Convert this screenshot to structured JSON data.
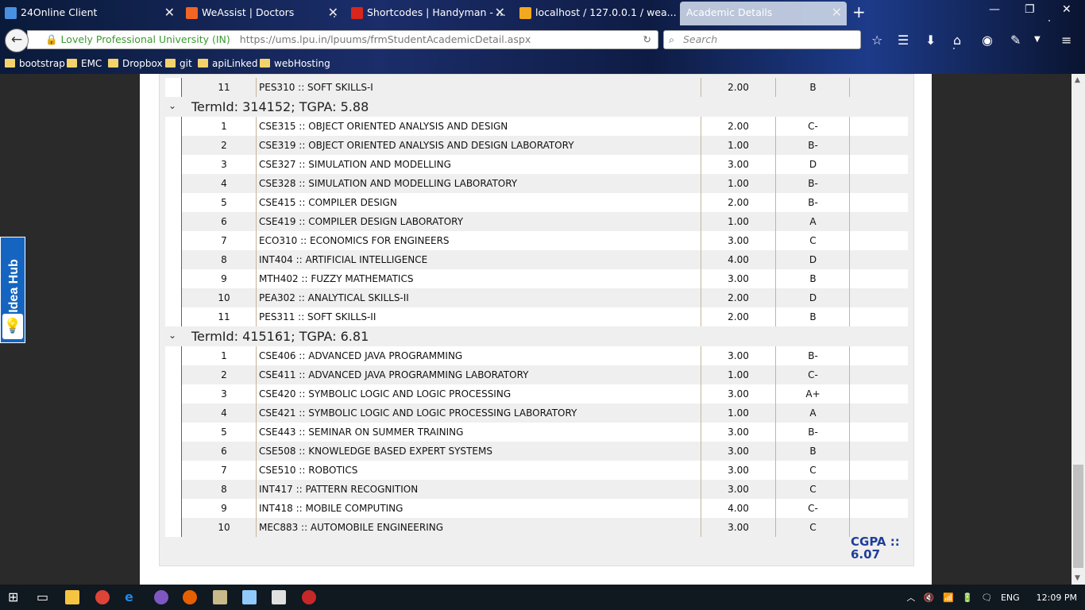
{
  "browser": {
    "tabs": [
      {
        "label": "24Online Client",
        "icon": "cloud-icon",
        "color": "#4a90e2"
      },
      {
        "label": "WeAssist | Doctors",
        "icon": "weassist-icon",
        "color": "#f26522"
      },
      {
        "label": "Shortcodes | Handyman - ...",
        "icon": "home-icon",
        "color": "#d9261c"
      },
      {
        "label": "localhost / 127.0.0.1 / wea...",
        "icon": "phpmyadmin-icon",
        "color": "#f4a81d"
      },
      {
        "label": "Academic Details",
        "icon": "",
        "color": ""
      }
    ],
    "new_tab": "+",
    "url_org": "Lovely Professional University (IN)",
    "url": "https://ums.lpu.in/lpuums/frmStudentAcademicDetail.aspx",
    "search_placeholder": "Search",
    "bookmarks": [
      "bootstrap",
      "EMC",
      "Dropbox",
      "git",
      "apiLinked",
      "webHosting"
    ]
  },
  "academic": {
    "top_row": {
      "sno": "11",
      "course": "PES310 :: SOFT SKILLS-I",
      "credits": "2.00",
      "grade": "B"
    },
    "terms": [
      {
        "title": "TermId: 314152; TGPA: 5.88",
        "rows": [
          {
            "sno": "1",
            "course": "CSE315 :: OBJECT ORIENTED ANALYSIS AND DESIGN",
            "credits": "2.00",
            "grade": "C-"
          },
          {
            "sno": "2",
            "course": "CSE319 :: OBJECT ORIENTED ANALYSIS AND DESIGN LABORATORY",
            "credits": "1.00",
            "grade": "B-"
          },
          {
            "sno": "3",
            "course": "CSE327 :: SIMULATION AND MODELLING",
            "credits": "3.00",
            "grade": "D"
          },
          {
            "sno": "4",
            "course": "CSE328 :: SIMULATION AND MODELLING LABORATORY",
            "credits": "1.00",
            "grade": "B-"
          },
          {
            "sno": "5",
            "course": "CSE415 :: COMPILER DESIGN",
            "credits": "2.00",
            "grade": "B-"
          },
          {
            "sno": "6",
            "course": "CSE419 :: COMPILER DESIGN LABORATORY",
            "credits": "1.00",
            "grade": "A"
          },
          {
            "sno": "7",
            "course": "ECO310 :: ECONOMICS FOR ENGINEERS",
            "credits": "3.00",
            "grade": "C"
          },
          {
            "sno": "8",
            "course": "INT404 :: ARTIFICIAL INTELLIGENCE",
            "credits": "4.00",
            "grade": "D"
          },
          {
            "sno": "9",
            "course": "MTH402 :: FUZZY MATHEMATICS",
            "credits": "3.00",
            "grade": "B"
          },
          {
            "sno": "10",
            "course": "PEA302 :: ANALYTICAL SKILLS-II",
            "credits": "2.00",
            "grade": "D"
          },
          {
            "sno": "11",
            "course": "PES311 :: SOFT SKILLS-II",
            "credits": "2.00",
            "grade": "B"
          }
        ]
      },
      {
        "title": "TermId: 415161; TGPA: 6.81",
        "rows": [
          {
            "sno": "1",
            "course": "CSE406 :: ADVANCED JAVA PROGRAMMING",
            "credits": "3.00",
            "grade": "B-"
          },
          {
            "sno": "2",
            "course": "CSE411 :: ADVANCED JAVA PROGRAMMING LABORATORY",
            "credits": "1.00",
            "grade": "C-"
          },
          {
            "sno": "3",
            "course": "CSE420 :: SYMBOLIC LOGIC AND LOGIC PROCESSING",
            "credits": "3.00",
            "grade": "A+"
          },
          {
            "sno": "4",
            "course": "CSE421 :: SYMBOLIC LOGIC AND LOGIC PROCESSING LABORATORY",
            "credits": "1.00",
            "grade": "A"
          },
          {
            "sno": "5",
            "course": "CSE443 :: SEMINAR ON SUMMER TRAINING",
            "credits": "3.00",
            "grade": "B-"
          },
          {
            "sno": "6",
            "course": "CSE508 :: KNOWLEDGE BASED EXPERT SYSTEMS",
            "credits": "3.00",
            "grade": "B"
          },
          {
            "sno": "7",
            "course": "CSE510 :: ROBOTICS",
            "credits": "3.00",
            "grade": "C"
          },
          {
            "sno": "8",
            "course": "INT417 :: PATTERN RECOGNITION",
            "credits": "3.00",
            "grade": "C"
          },
          {
            "sno": "9",
            "course": "INT418 :: MOBILE COMPUTING",
            "credits": "4.00",
            "grade": "C-"
          },
          {
            "sno": "10",
            "course": "MEC883 :: AUTOMOBILE ENGINEERING",
            "credits": "3.00",
            "grade": "C"
          }
        ]
      }
    ],
    "cgpa_label": "CGPA ::",
    "cgpa_value": "6.07"
  },
  "idea_hub": {
    "label": "Idea Hub"
  },
  "taskbar": {
    "lang": "ENG",
    "time": "12:09 PM"
  }
}
